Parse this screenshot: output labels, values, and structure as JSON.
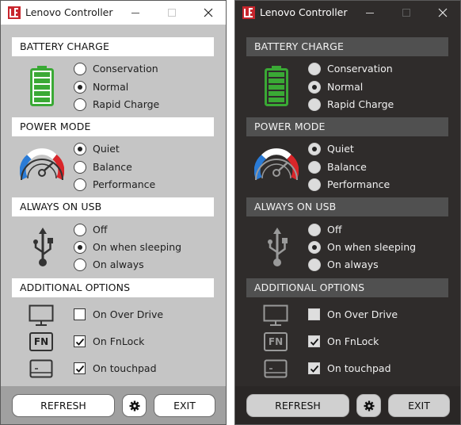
{
  "window_title": "Lenovo Controller",
  "sections": {
    "battery": {
      "title": "BATTERY CHARGE",
      "options": [
        "Conservation",
        "Normal",
        "Rapid Charge"
      ],
      "selected": 1
    },
    "power": {
      "title": "POWER MODE",
      "options": [
        "Quiet",
        "Balance",
        "Performance"
      ],
      "selected": 0
    },
    "usb": {
      "title": "ALWAYS ON USB",
      "options": [
        "Off",
        "On when sleeping",
        "On always"
      ],
      "selected": 1
    },
    "additional": {
      "title": "ADDITIONAL OPTIONS",
      "options": [
        "On Over Drive",
        "On FnLock",
        "On touchpad"
      ],
      "checked": [
        false,
        true,
        true
      ]
    }
  },
  "fn_key_label": "FN",
  "footer": {
    "refresh_label": "REFRESH",
    "exit_label": "EXIT",
    "settings_icon": "gear-icon"
  },
  "themes": [
    "light",
    "dark"
  ],
  "colors": {
    "logo_red": "#c8262d",
    "battery_green": "#3aa935",
    "gauge_blue": "#2a7bd6",
    "gauge_red": "#d9262a"
  }
}
